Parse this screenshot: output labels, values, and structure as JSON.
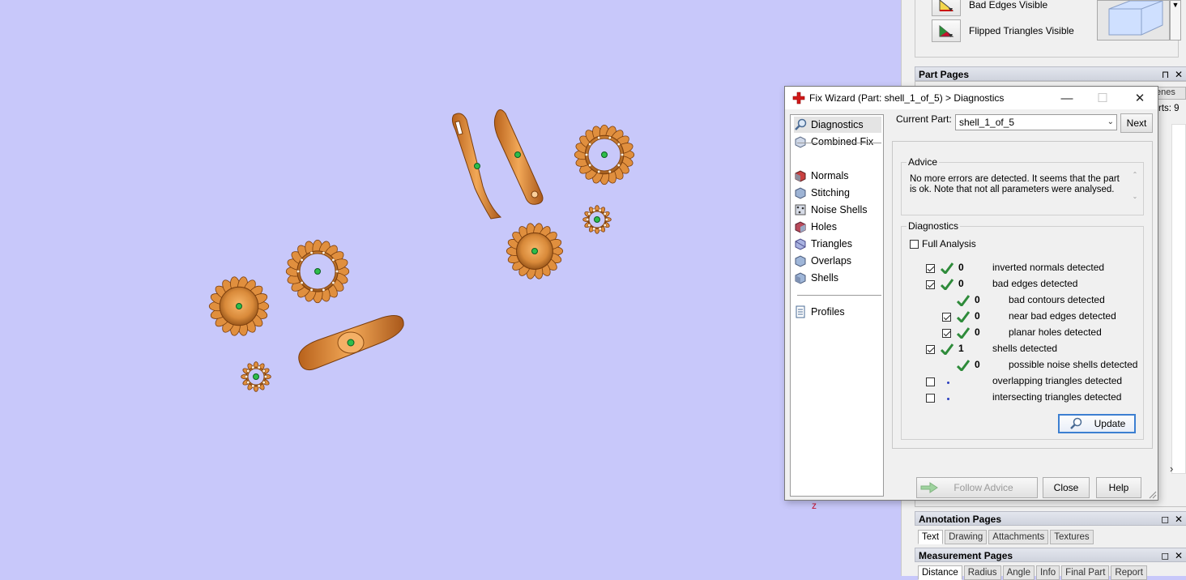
{
  "colors": {
    "viewport_bg": "#c8c8fa",
    "part_orange": "#d98a3a",
    "part_dark": "#8a4a12",
    "marker_green": "#2dbd4a",
    "tick_green": "#2e8b3a",
    "focus_blue": "#3c7fd1"
  },
  "right_panel": {
    "visibility_items": [
      {
        "label": "Bad Edges Visible",
        "icon": "bad-edges-icon"
      },
      {
        "label": "Flipped Triangles Visible",
        "icon": "flipped-triangles-icon"
      }
    ],
    "cube_dropdown_arrow": "▼",
    "part_pages": {
      "title": "Part Pages",
      "tabs_visible": "enes",
      "parts_count_text": "rts: 9"
    },
    "annotation_pages": {
      "title": "Annotation Pages",
      "tabs": [
        "Text",
        "Drawing",
        "Attachments",
        "Textures"
      ]
    },
    "measurement_pages": {
      "title": "Measurement Pages",
      "tabs": [
        "Distance",
        "Radius",
        "Angle",
        "Info",
        "Final Part",
        "Report"
      ]
    },
    "header_controls": {
      "pin": "⊓",
      "float": "◻",
      "close": "✕"
    },
    "scroll_arrow": "›"
  },
  "viewport": {
    "axis_label": "z"
  },
  "dialog": {
    "title": "Fix Wizard (Part: shell_1_of_5) > Diagnostics",
    "window_buttons": {
      "minimize": "—",
      "maximize": "☐",
      "close": "✕"
    },
    "nav": [
      {
        "label": "Diagnostics",
        "icon": "magnifier-icon",
        "selected": true
      },
      {
        "label": "Combined Fix",
        "icon": "combined-fix-icon"
      },
      {
        "label": "Normals",
        "icon": "normals-cube-icon"
      },
      {
        "label": "Stitching",
        "icon": "stitching-cube-icon"
      },
      {
        "label": "Noise Shells",
        "icon": "noise-shells-icon"
      },
      {
        "label": "Holes",
        "icon": "holes-cube-icon"
      },
      {
        "label": "Triangles",
        "icon": "triangles-cube-icon"
      },
      {
        "label": "Overlaps",
        "icon": "overlaps-cube-icon"
      },
      {
        "label": "Shells",
        "icon": "shells-cube-icon"
      },
      {
        "label": "Profiles",
        "icon": "profiles-doc-icon"
      }
    ],
    "current_part_label": "Current Part:",
    "current_part_value": "shell_1_of_5",
    "next_button": "Next",
    "advice": {
      "legend": "Advice",
      "text": "No more errors are detected. It seems that the part is ok. Note that not all parameters were analysed."
    },
    "diagnostics": {
      "legend": "Diagnostics",
      "full_analysis_label": "Full Analysis",
      "full_analysis_checked": false,
      "rows": [
        {
          "checkbox": true,
          "checked": true,
          "status": "ok",
          "count": "0",
          "label": "inverted normals detected",
          "indent": 0
        },
        {
          "checkbox": true,
          "checked": true,
          "status": "ok",
          "count": "0",
          "label": "bad edges detected",
          "indent": 0
        },
        {
          "checkbox": false,
          "checked": false,
          "status": "ok",
          "count": "0",
          "label": "bad contours detected",
          "indent": 1
        },
        {
          "checkbox": true,
          "checked": true,
          "status": "ok",
          "count": "0",
          "label": "near bad edges detected",
          "indent": 1
        },
        {
          "checkbox": true,
          "checked": true,
          "status": "ok",
          "count": "0",
          "label": "planar holes detected",
          "indent": 1
        },
        {
          "checkbox": true,
          "checked": true,
          "status": "ok",
          "count": "1",
          "label": "shells detected",
          "indent": 0
        },
        {
          "checkbox": false,
          "checked": false,
          "status": "ok",
          "count": "0",
          "label": "possible noise shells detected",
          "indent": 1
        },
        {
          "checkbox": true,
          "checked": false,
          "status": "pending",
          "count": "",
          "label": "overlapping triangles detected",
          "indent": 0
        },
        {
          "checkbox": true,
          "checked": false,
          "status": "pending",
          "count": "",
          "label": "intersecting triangles detected",
          "indent": 0
        }
      ]
    },
    "update_button": "Update",
    "follow_advice_button": "Follow Advice",
    "close_button": "Close",
    "help_button": "Help"
  }
}
